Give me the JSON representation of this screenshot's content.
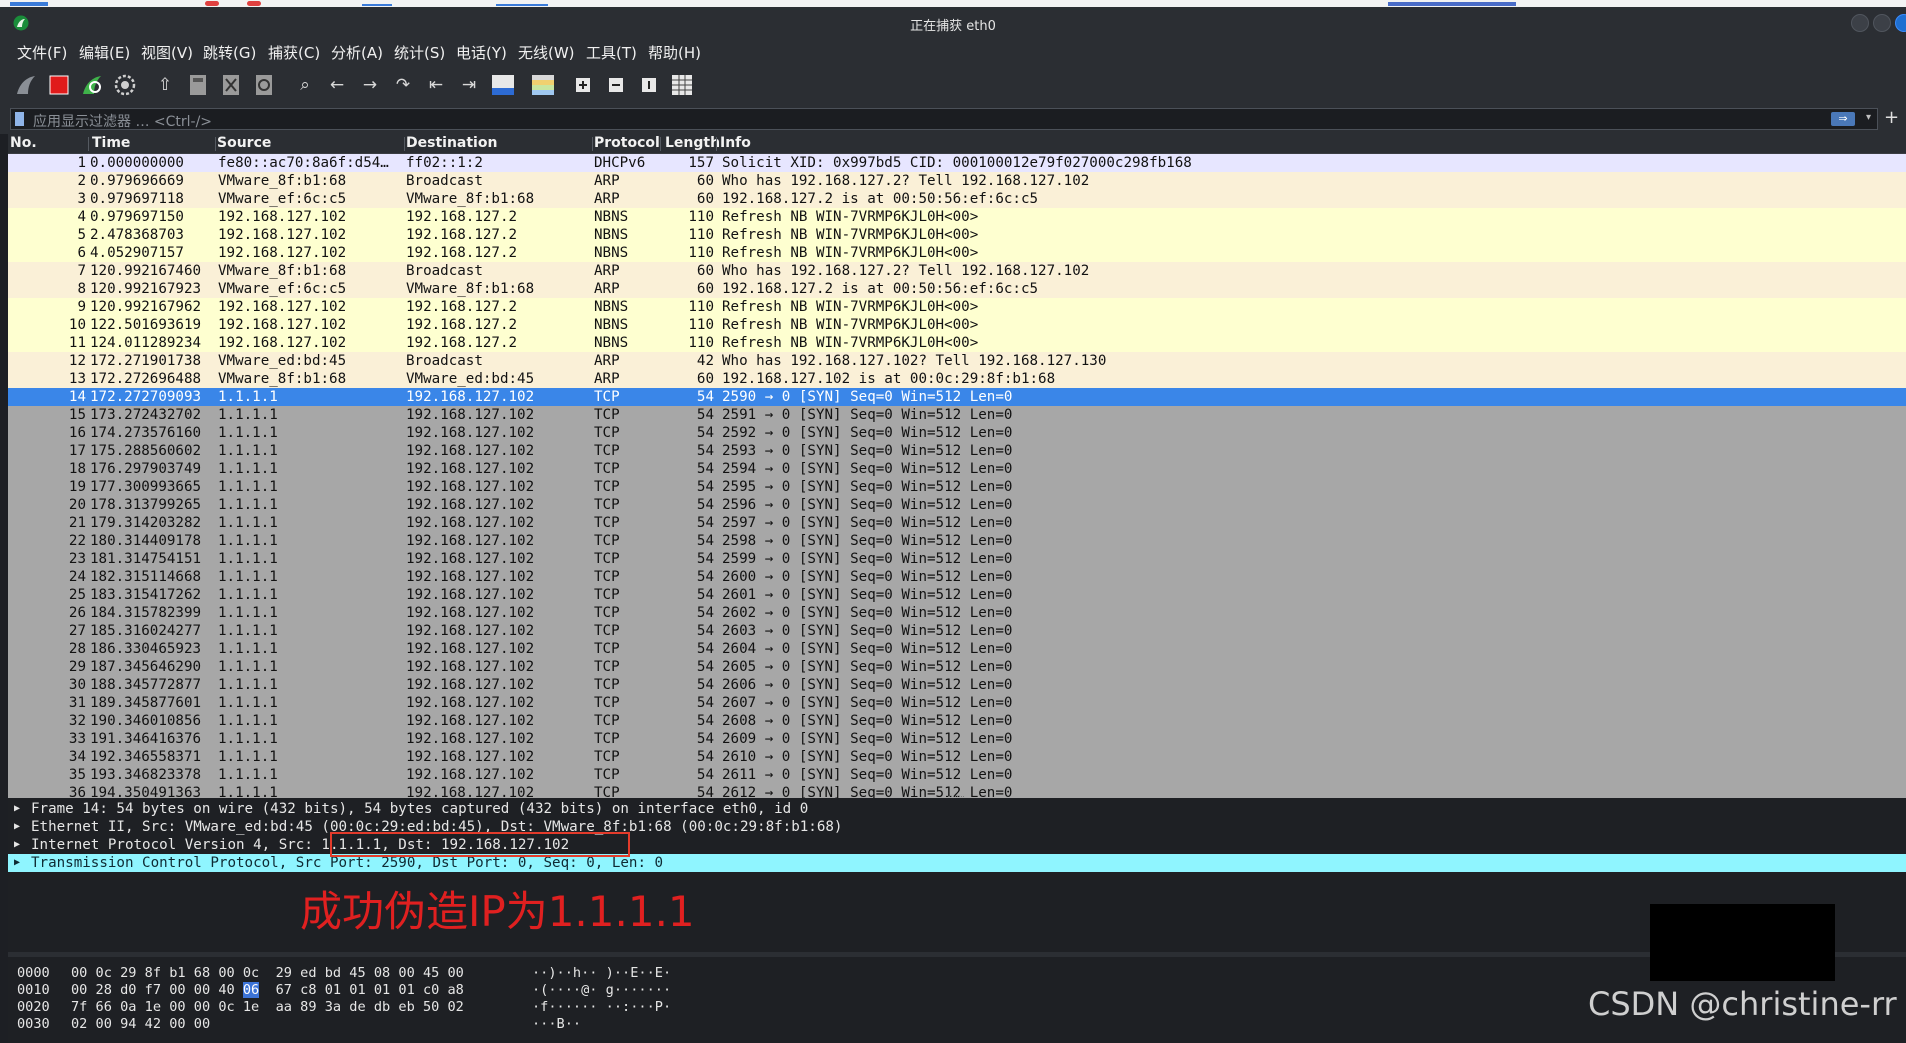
{
  "window": {
    "title": "正在捕获 eth0"
  },
  "menu": [
    "文件(F)",
    "编辑(E)",
    "视图(V)",
    "跳转(G)",
    "捕获(C)",
    "分析(A)",
    "统计(S)",
    "电话(Y)",
    "无线(W)",
    "工具(T)",
    "帮助(H)"
  ],
  "toolbar": {
    "icons": [
      "shark-fin-start-icon",
      "stop-capture-icon",
      "restart-capture-icon",
      "capture-options-icon",
      "open-file-icon",
      "save-file-icon",
      "close-file-icon",
      "reload-file-icon",
      "find-packet-icon",
      "go-back-icon",
      "go-forward-icon",
      "go-to-packet-icon",
      "first-packet-icon",
      "last-packet-icon",
      "auto-scroll-icon",
      "colorize-icon",
      "zoom-in-icon",
      "zoom-out-icon",
      "normal-size-icon",
      "resize-columns-icon"
    ]
  },
  "filter": {
    "placeholder": "应用显示过滤器 … <Ctrl-/>"
  },
  "columns": {
    "no": "No.",
    "time": "Time",
    "source": "Source",
    "destination": "Destination",
    "protocol": "Protocol",
    "length": "Length",
    "info": "Info"
  },
  "packets": [
    {
      "no": "1",
      "time": "0.000000000",
      "src": "fe80::ac70:8a6f:d54…",
      "dst": "ff02::1:2",
      "proto": "DHCPv6",
      "len": "157",
      "info": "Solicit XID: 0x997bd5 CID: 000100012e79f027000c298fb168",
      "bg": "#e7e6ff"
    },
    {
      "no": "2",
      "time": "0.979696669",
      "src": "VMware_8f:b1:68",
      "dst": "Broadcast",
      "proto": "ARP",
      "len": "60",
      "info": "Who has 192.168.127.2? Tell 192.168.127.102",
      "bg": "#faf0d7"
    },
    {
      "no": "3",
      "time": "0.979697118",
      "src": "VMware_ef:6c:c5",
      "dst": "VMware_8f:b1:68",
      "proto": "ARP",
      "len": "60",
      "info": "192.168.127.2 is at 00:50:56:ef:6c:c5",
      "bg": "#faf0d7"
    },
    {
      "no": "4",
      "time": "0.979697150",
      "src": "192.168.127.102",
      "dst": "192.168.127.2",
      "proto": "NBNS",
      "len": "110",
      "info": "Refresh NB WIN-7VRMP6KJL0H<00>",
      "bg": "#feffd0"
    },
    {
      "no": "5",
      "time": "2.478368703",
      "src": "192.168.127.102",
      "dst": "192.168.127.2",
      "proto": "NBNS",
      "len": "110",
      "info": "Refresh NB WIN-7VRMP6KJL0H<00>",
      "bg": "#feffd0"
    },
    {
      "no": "6",
      "time": "4.052907157",
      "src": "192.168.127.102",
      "dst": "192.168.127.2",
      "proto": "NBNS",
      "len": "110",
      "info": "Refresh NB WIN-7VRMP6KJL0H<00>",
      "bg": "#feffd0"
    },
    {
      "no": "7",
      "time": "120.992167460",
      "src": "VMware_8f:b1:68",
      "dst": "Broadcast",
      "proto": "ARP",
      "len": "60",
      "info": "Who has 192.168.127.2? Tell 192.168.127.102",
      "bg": "#faf0d7"
    },
    {
      "no": "8",
      "time": "120.992167923",
      "src": "VMware_ef:6c:c5",
      "dst": "VMware_8f:b1:68",
      "proto": "ARP",
      "len": "60",
      "info": "192.168.127.2 is at 00:50:56:ef:6c:c5",
      "bg": "#faf0d7"
    },
    {
      "no": "9",
      "time": "120.992167962",
      "src": "192.168.127.102",
      "dst": "192.168.127.2",
      "proto": "NBNS",
      "len": "110",
      "info": "Refresh NB WIN-7VRMP6KJL0H<00>",
      "bg": "#feffd0"
    },
    {
      "no": "10",
      "time": "122.501693619",
      "src": "192.168.127.102",
      "dst": "192.168.127.2",
      "proto": "NBNS",
      "len": "110",
      "info": "Refresh NB WIN-7VRMP6KJL0H<00>",
      "bg": "#feffd0"
    },
    {
      "no": "11",
      "time": "124.011289234",
      "src": "192.168.127.102",
      "dst": "192.168.127.2",
      "proto": "NBNS",
      "len": "110",
      "info": "Refresh NB WIN-7VRMP6KJL0H<00>",
      "bg": "#feffd0"
    },
    {
      "no": "12",
      "time": "172.271901738",
      "src": "VMware_ed:bd:45",
      "dst": "Broadcast",
      "proto": "ARP",
      "len": "42",
      "info": "Who has 192.168.127.102? Tell 192.168.127.130",
      "bg": "#faf0d7"
    },
    {
      "no": "13",
      "time": "172.272696488",
      "src": "VMware_8f:b1:68",
      "dst": "VMware_ed:bd:45",
      "proto": "ARP",
      "len": "60",
      "info": "192.168.127.102 is at 00:0c:29:8f:b1:68",
      "bg": "#faf0d7"
    },
    {
      "no": "14",
      "time": "172.272709093",
      "src": "1.1.1.1",
      "dst": "192.168.127.102",
      "proto": "TCP",
      "len": "54",
      "info": "2590 → 0 [SYN] Seq=0 Win=512 Len=0",
      "bg": "#3a86e8",
      "sel": true
    },
    {
      "no": "15",
      "time": "173.272432702",
      "src": "1.1.1.1",
      "dst": "192.168.127.102",
      "proto": "TCP",
      "len": "54",
      "info": "2591 → 0 [SYN] Seq=0 Win=512 Len=0",
      "bg": "#a7a7a7"
    },
    {
      "no": "16",
      "time": "174.273576160",
      "src": "1.1.1.1",
      "dst": "192.168.127.102",
      "proto": "TCP",
      "len": "54",
      "info": "2592 → 0 [SYN] Seq=0 Win=512 Len=0",
      "bg": "#a7a7a7"
    },
    {
      "no": "17",
      "time": "175.288560602",
      "src": "1.1.1.1",
      "dst": "192.168.127.102",
      "proto": "TCP",
      "len": "54",
      "info": "2593 → 0 [SYN] Seq=0 Win=512 Len=0",
      "bg": "#a7a7a7"
    },
    {
      "no": "18",
      "time": "176.297903749",
      "src": "1.1.1.1",
      "dst": "192.168.127.102",
      "proto": "TCP",
      "len": "54",
      "info": "2594 → 0 [SYN] Seq=0 Win=512 Len=0",
      "bg": "#a7a7a7"
    },
    {
      "no": "19",
      "time": "177.300993665",
      "src": "1.1.1.1",
      "dst": "192.168.127.102",
      "proto": "TCP",
      "len": "54",
      "info": "2595 → 0 [SYN] Seq=0 Win=512 Len=0",
      "bg": "#a7a7a7"
    },
    {
      "no": "20",
      "time": "178.313799265",
      "src": "1.1.1.1",
      "dst": "192.168.127.102",
      "proto": "TCP",
      "len": "54",
      "info": "2596 → 0 [SYN] Seq=0 Win=512 Len=0",
      "bg": "#a7a7a7"
    },
    {
      "no": "21",
      "time": "179.314203282",
      "src": "1.1.1.1",
      "dst": "192.168.127.102",
      "proto": "TCP",
      "len": "54",
      "info": "2597 → 0 [SYN] Seq=0 Win=512 Len=0",
      "bg": "#a7a7a7"
    },
    {
      "no": "22",
      "time": "180.314409178",
      "src": "1.1.1.1",
      "dst": "192.168.127.102",
      "proto": "TCP",
      "len": "54",
      "info": "2598 → 0 [SYN] Seq=0 Win=512 Len=0",
      "bg": "#a7a7a7"
    },
    {
      "no": "23",
      "time": "181.314754151",
      "src": "1.1.1.1",
      "dst": "192.168.127.102",
      "proto": "TCP",
      "len": "54",
      "info": "2599 → 0 [SYN] Seq=0 Win=512 Len=0",
      "bg": "#a7a7a7"
    },
    {
      "no": "24",
      "time": "182.315114668",
      "src": "1.1.1.1",
      "dst": "192.168.127.102",
      "proto": "TCP",
      "len": "54",
      "info": "2600 → 0 [SYN] Seq=0 Win=512 Len=0",
      "bg": "#a7a7a7"
    },
    {
      "no": "25",
      "time": "183.315417262",
      "src": "1.1.1.1",
      "dst": "192.168.127.102",
      "proto": "TCP",
      "len": "54",
      "info": "2601 → 0 [SYN] Seq=0 Win=512 Len=0",
      "bg": "#a7a7a7"
    },
    {
      "no": "26",
      "time": "184.315782399",
      "src": "1.1.1.1",
      "dst": "192.168.127.102",
      "proto": "TCP",
      "len": "54",
      "info": "2602 → 0 [SYN] Seq=0 Win=512 Len=0",
      "bg": "#a7a7a7"
    },
    {
      "no": "27",
      "time": "185.316024277",
      "src": "1.1.1.1",
      "dst": "192.168.127.102",
      "proto": "TCP",
      "len": "54",
      "info": "2603 → 0 [SYN] Seq=0 Win=512 Len=0",
      "bg": "#a7a7a7"
    },
    {
      "no": "28",
      "time": "186.330465923",
      "src": "1.1.1.1",
      "dst": "192.168.127.102",
      "proto": "TCP",
      "len": "54",
      "info": "2604 → 0 [SYN] Seq=0 Win=512 Len=0",
      "bg": "#a7a7a7"
    },
    {
      "no": "29",
      "time": "187.345646290",
      "src": "1.1.1.1",
      "dst": "192.168.127.102",
      "proto": "TCP",
      "len": "54",
      "info": "2605 → 0 [SYN] Seq=0 Win=512 Len=0",
      "bg": "#a7a7a7"
    },
    {
      "no": "30",
      "time": "188.345772877",
      "src": "1.1.1.1",
      "dst": "192.168.127.102",
      "proto": "TCP",
      "len": "54",
      "info": "2606 → 0 [SYN] Seq=0 Win=512 Len=0",
      "bg": "#a7a7a7"
    },
    {
      "no": "31",
      "time": "189.345877601",
      "src": "1.1.1.1",
      "dst": "192.168.127.102",
      "proto": "TCP",
      "len": "54",
      "info": "2607 → 0 [SYN] Seq=0 Win=512 Len=0",
      "bg": "#a7a7a7"
    },
    {
      "no": "32",
      "time": "190.346010856",
      "src": "1.1.1.1",
      "dst": "192.168.127.102",
      "proto": "TCP",
      "len": "54",
      "info": "2608 → 0 [SYN] Seq=0 Win=512 Len=0",
      "bg": "#a7a7a7"
    },
    {
      "no": "33",
      "time": "191.346416376",
      "src": "1.1.1.1",
      "dst": "192.168.127.102",
      "proto": "TCP",
      "len": "54",
      "info": "2609 → 0 [SYN] Seq=0 Win=512 Len=0",
      "bg": "#a7a7a7"
    },
    {
      "no": "34",
      "time": "192.346558371",
      "src": "1.1.1.1",
      "dst": "192.168.127.102",
      "proto": "TCP",
      "len": "54",
      "info": "2610 → 0 [SYN] Seq=0 Win=512 Len=0",
      "bg": "#a7a7a7"
    },
    {
      "no": "35",
      "time": "193.346823378",
      "src": "1.1.1.1",
      "dst": "192.168.127.102",
      "proto": "TCP",
      "len": "54",
      "info": "2611 → 0 [SYN] Seq=0 Win=512 Len=0",
      "bg": "#a7a7a7"
    },
    {
      "no": "36",
      "time": "194.350491363",
      "src": "1.1.1.1",
      "dst": "192.168.127.102",
      "proto": "TCP",
      "len": "54",
      "info": "2612 → 0 [SYN] Seq=0 Win=512 Len=0",
      "bg": "#a7a7a7"
    }
  ],
  "details": [
    {
      "text": "Frame 14: 54 bytes on wire (432 bits), 54 bytes captured (432 bits) on interface eth0, id 0"
    },
    {
      "text": "Ethernet II, Src: VMware_ed:bd:45 (00:0c:29:ed:bd:45), Dst: VMware_8f:b1:68 (00:0c:29:8f:b1:68)"
    },
    {
      "text": "Internet Protocol Version 4, Src: 1.1.1.1, Dst: 192.168.127.102"
    },
    {
      "text": "Transmission Control Protocol, Src Port: 2590, Dst Port: 0, Seq: 0, Len: 0",
      "highlight": true
    }
  ],
  "annotation": {
    "text": "成功伪造IP为1.1.1.1",
    "color": "#e02020"
  },
  "bytes": [
    {
      "offset": "0000",
      "hex_a": "00 0c 29 8f b1 68 00 0c",
      "hex_b": "29 ed bd 45 08 00 45 00",
      "ascii": "··)··h·· )··E··E·"
    },
    {
      "offset": "0010",
      "hex_a": "00 28 d0 f7 00 00 40 ",
      "hex_sel": "06",
      "hex_b": "67 c8 01 01 01 01 c0 a8",
      "ascii": "·(····@· g·······"
    },
    {
      "offset": "0020",
      "hex_a": "7f 66 0a 1e 00 00 0c 1e",
      "hex_b": "aa 89 3a de db eb 50 02",
      "ascii": "·f······ ··:···P·"
    },
    {
      "offset": "0030",
      "hex_a": "02 00 94 42 00 00",
      "hex_b": "",
      "ascii": "···B··"
    }
  ],
  "watermark": "CSDN @christine-rr",
  "colors": {
    "selected_row": "#3a86e8",
    "detail_highlight": "#8ff5ff",
    "annotation_red": "#e33b2b"
  }
}
